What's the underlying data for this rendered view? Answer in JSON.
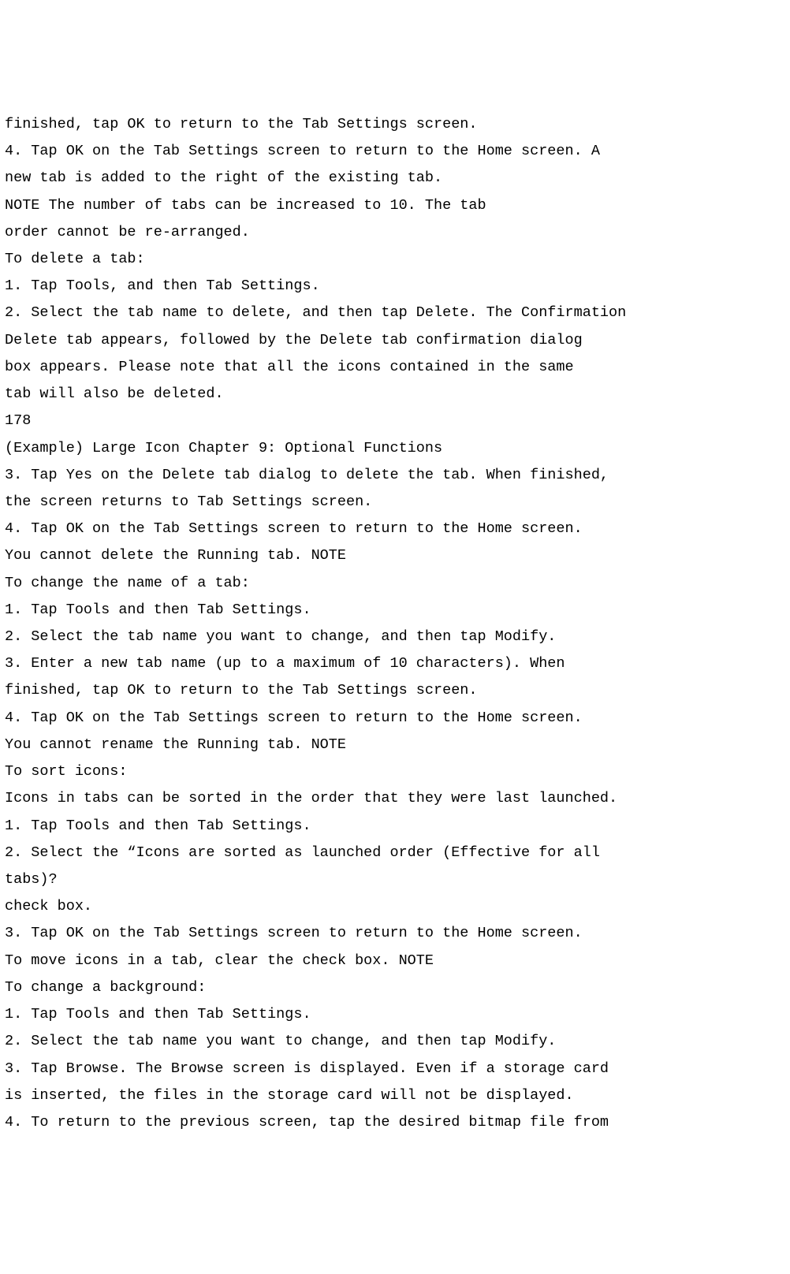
{
  "lines": [
    "finished, tap OK to return to the Tab Settings screen.",
    "4. Tap OK on the Tab Settings screen to return to the Home screen. A",
    "new tab is added to the right of the existing tab.",
    "NOTE The number of tabs can be increased to 10. The tab",
    "order cannot be re-arranged.",
    "To delete a tab:",
    "1. Tap Tools, and then Tab Settings.",
    "2. Select the tab name to delete, and then tap Delete. The Confirmation",
    "Delete tab appears, followed by the Delete tab confirmation dialog",
    "box appears. Please note that all the icons contained in the same",
    "tab will also be deleted.",
    "178",
    "(Example) Large Icon Chapter 9: Optional Functions",
    "3. Tap Yes on the Delete tab dialog to delete the tab. When finished,",
    "the screen returns to Tab Settings screen.",
    "4. Tap OK on the Tab Settings screen to return to the Home screen.",
    "You cannot delete the Running tab. NOTE",
    "To change the name of a tab:",
    "1. Tap Tools and then Tab Settings.",
    "2. Select the tab name you want to change, and then tap Modify.",
    "3. Enter a new tab name (up to a maximum of 10 characters). When",
    "finished, tap OK to return to the Tab Settings screen.",
    "4. Tap OK on the Tab Settings screen to return to the Home screen.",
    "You cannot rename the Running tab. NOTE",
    "To sort icons:",
    "Icons in tabs can be sorted in the order that they were last launched.",
    "1. Tap Tools and then Tab Settings.",
    "2. Select the “Icons are sorted as launched order (Effective for all",
    "tabs)?",
    "check box.",
    "3. Tap OK on the Tab Settings screen to return to the Home screen.",
    "To move icons in a tab, clear the check box. NOTE",
    "To change a background:",
    "1. Tap Tools and then Tab Settings.",
    "2. Select the tab name you want to change, and then tap Modify.",
    "3. Tap Browse. The Browse screen is displayed. Even if a storage card",
    "is inserted, the files in the storage card will not be displayed.",
    "4. To return to the previous screen, tap the desired bitmap file from"
  ]
}
